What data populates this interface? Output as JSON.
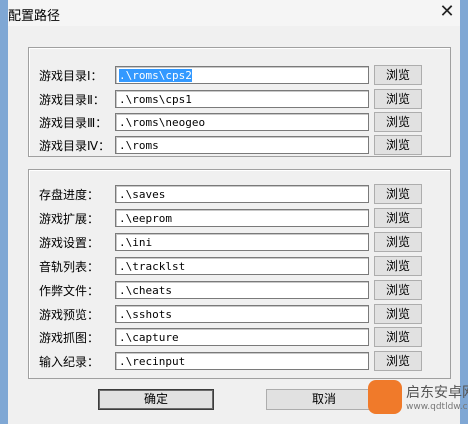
{
  "window": {
    "title": "配置路径",
    "close_glyph": "✕"
  },
  "rom_paths": [
    {
      "label": "游戏目录Ⅰ：",
      "value": ".\\roms\\cps2",
      "browse": "浏览"
    },
    {
      "label": "游戏目录Ⅱ：",
      "value": ".\\roms\\cps1",
      "browse": "浏览"
    },
    {
      "label": "游戏目录Ⅲ：",
      "value": ".\\roms\\neogeo",
      "browse": "浏览"
    },
    {
      "label": "游戏目录Ⅳ：",
      "value": ".\\roms",
      "browse": "浏览"
    }
  ],
  "other_paths": [
    {
      "label": "存盘进度：",
      "value": ".\\saves",
      "browse": "浏览"
    },
    {
      "label": "游戏扩展：",
      "value": ".\\eeprom",
      "browse": "浏览"
    },
    {
      "label": "游戏设置：",
      "value": ".\\ini",
      "browse": "浏览"
    },
    {
      "label": "音轨列表：",
      "value": ".\\tracklst",
      "browse": "浏览"
    },
    {
      "label": "作弊文件：",
      "value": ".\\cheats",
      "browse": "浏览"
    },
    {
      "label": "游戏预览：",
      "value": ".\\sshots",
      "browse": "浏览"
    },
    {
      "label": "游戏抓图：",
      "value": ".\\capture",
      "browse": "浏览"
    },
    {
      "label": "输入纪录：",
      "value": ".\\recinput",
      "browse": "浏览"
    }
  ],
  "footer": {
    "ok_label": "确定",
    "cancel_label": "取消"
  },
  "watermark": {
    "name": "启东安卓网",
    "url": "www.qdtldw.com",
    "color": "#f07a2a"
  }
}
